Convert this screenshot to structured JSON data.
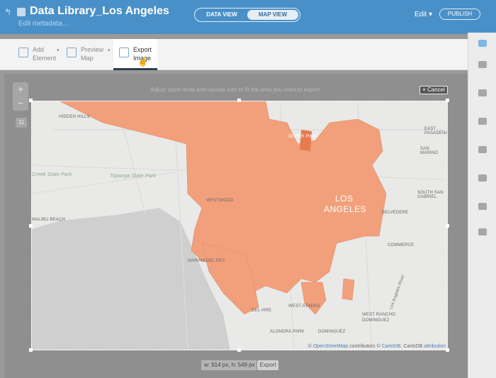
{
  "header": {
    "title": "Data Library_Los Angeles",
    "subtitle": "Edit metadata...",
    "tabs": [
      "DATA VIEW",
      "MAP VIEW"
    ],
    "edit_menu": "Edit",
    "publish": "PUBLISH"
  },
  "toolbar": {
    "add_element": "Add\nElement",
    "preview_map": "Preview\nMap",
    "export_image": "Export\nImage"
  },
  "map": {
    "hint": "Adjust zoom level and canvas size to fit the area you want to export.",
    "cancel": "× Cancel",
    "zoom_in": "+",
    "zoom_out": "−",
    "zoom_level": "11",
    "labels": {
      "hidden_hills": "HIDDEN HILLS",
      "topanga": "Topanga State Park",
      "creek": "Creek State Park",
      "griffith": "Griffith Park",
      "east_pasadena": "EAST PASADENA",
      "san_marino": "SAN MARINO",
      "south_san_gabriel": "SOUTH SAN GABRIEL",
      "westwood": "WESTWOOD",
      "la_line1": "LOS",
      "la_line2": "ANGELES",
      "belvedere": "BELVEDERE",
      "malibu": "MALIBU BEACH",
      "commerce": "COMMERCE",
      "marina": "MARINA DEL REY",
      "la_river": "Los Angeles River",
      "west_athens": "WEST ATHENS",
      "del_aire": "DEL AIRE",
      "west_rancho": "WEST RANCHO",
      "dominguez1": "DOMINGUEZ",
      "alondra": "ALONDRA PARK",
      "dominguez2": "DOMINGUEZ"
    },
    "attribution": {
      "prefix": "©",
      "osm": "OpenStreetMap",
      "middle": "contributors ©",
      "cartodb": "CartoDB",
      "mid2": ", CartoDB",
      "attribution": "attribution"
    }
  },
  "export": {
    "size": "w: 914 px, h: 549 px",
    "button": "Export"
  },
  "colors": {
    "header": "#4a90c8",
    "choropleth": "#f2a07b",
    "water": "#cfcfcf"
  }
}
